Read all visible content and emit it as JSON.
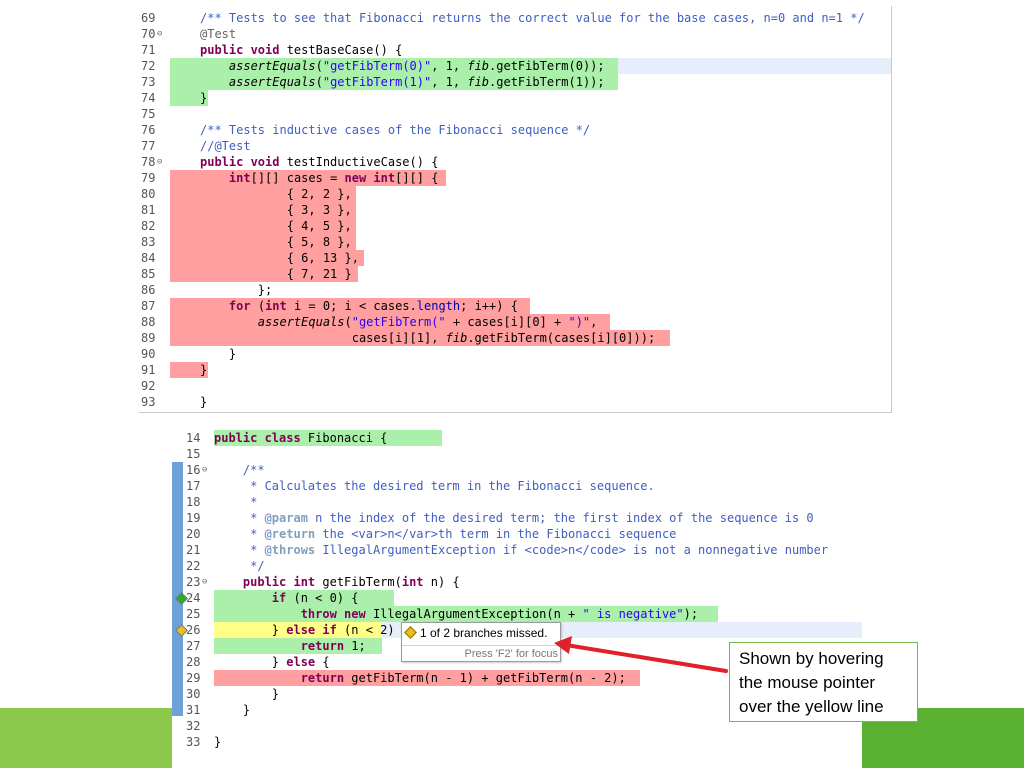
{
  "test_file": {
    "lines": [
      {
        "n": "69",
        "hl": "none",
        "parts": [
          [
            "cm",
            "/** Tests to see that Fibonacci returns the correct value for the base cases, n=0 and n=1 */"
          ]
        ]
      },
      {
        "n": "70",
        "fold": "⊖",
        "hl": "none",
        "parts": [
          [
            "ann",
            "@Test"
          ]
        ]
      },
      {
        "n": "71",
        "hl": "none",
        "parts": [
          [
            "kw",
            "public void "
          ],
          [
            "",
            "testBaseCase() {"
          ]
        ]
      },
      {
        "n": "72",
        "hl": "green",
        "cur": true,
        "parts": [
          [
            "",
            "    "
          ],
          [
            "st",
            "assertEquals"
          ],
          [
            "",
            "("
          ],
          [
            "str",
            "\"getFibTerm(0)\""
          ],
          [
            "",
            ", 1, "
          ],
          [
            "st",
            "fib"
          ],
          [
            "",
            ".getFibTerm(0));"
          ]
        ]
      },
      {
        "n": "73",
        "hl": "green",
        "parts": [
          [
            "",
            "    "
          ],
          [
            "st",
            "assertEquals"
          ],
          [
            "",
            "("
          ],
          [
            "str",
            "\"getFibTerm(1)\""
          ],
          [
            "",
            ", 1, "
          ],
          [
            "st",
            "fib"
          ],
          [
            "",
            ".getFibTerm(1));"
          ]
        ]
      },
      {
        "n": "74",
        "hl": "green-short",
        "parts": [
          [
            "",
            "}"
          ]
        ]
      },
      {
        "n": "75",
        "hl": "none",
        "parts": []
      },
      {
        "n": "76",
        "hl": "none",
        "parts": [
          [
            "cm",
            "/** Tests inductive cases of the Fibonacci sequence */"
          ]
        ]
      },
      {
        "n": "77",
        "hl": "none",
        "parts": [
          [
            "cm",
            "//@Test"
          ]
        ]
      },
      {
        "n": "78",
        "fold": "⊖",
        "hl": "none",
        "parts": [
          [
            "kw",
            "public void "
          ],
          [
            "",
            "testInductiveCase() {"
          ]
        ]
      },
      {
        "n": "79",
        "hl": "red",
        "w": 276,
        "parts": [
          [
            "",
            "    "
          ],
          [
            "kw",
            "int"
          ],
          [
            "",
            "[][] cases = "
          ],
          [
            "kw",
            "new int"
          ],
          [
            "",
            "[][] {"
          ]
        ]
      },
      {
        "n": "80",
        "hl": "red",
        "w": 186,
        "parts": [
          [
            "",
            "            { 2, 2 },"
          ]
        ]
      },
      {
        "n": "81",
        "hl": "red",
        "w": 186,
        "parts": [
          [
            "",
            "            { 3, 3 },"
          ]
        ]
      },
      {
        "n": "82",
        "hl": "red",
        "w": 186,
        "parts": [
          [
            "",
            "            { 4, 5 },"
          ]
        ]
      },
      {
        "n": "83",
        "hl": "red",
        "w": 186,
        "parts": [
          [
            "",
            "            { 5, 8 },"
          ]
        ]
      },
      {
        "n": "84",
        "hl": "red",
        "w": 194,
        "parts": [
          [
            "",
            "            { 6, 13 },"
          ]
        ]
      },
      {
        "n": "85",
        "hl": "red",
        "w": 188,
        "parts": [
          [
            "",
            "            { 7, 21 }"
          ]
        ]
      },
      {
        "n": "86",
        "hl": "none",
        "parts": [
          [
            "",
            "        };"
          ]
        ]
      },
      {
        "n": "87",
        "hl": "red",
        "w": 360,
        "parts": [
          [
            "",
            "    "
          ],
          [
            "kw",
            "for "
          ],
          [
            "",
            "("
          ],
          [
            "kw",
            "int "
          ],
          [
            "",
            "i = 0; i < cases."
          ],
          [
            "fld",
            "length"
          ],
          [
            "",
            "; i++) {"
          ]
        ]
      },
      {
        "n": "88",
        "hl": "red",
        "w": 440,
        "parts": [
          [
            "",
            "        "
          ],
          [
            "st",
            "assertEquals"
          ],
          [
            "",
            "("
          ],
          [
            "str",
            "\"getFibTerm(\""
          ],
          [
            "",
            " + cases[i][0] + "
          ],
          [
            "str",
            "\")\""
          ],
          [
            "",
            ","
          ]
        ]
      },
      {
        "n": "89",
        "hl": "red",
        "w": 500,
        "parts": [
          [
            "",
            "                     cases[i][1], "
          ],
          [
            "st",
            "fib"
          ],
          [
            "",
            ".getFibTerm(cases[i][0]));"
          ]
        ]
      },
      {
        "n": "90",
        "hl": "none",
        "parts": [
          [
            "",
            "    }"
          ]
        ]
      },
      {
        "n": "91",
        "hl": "red-short",
        "parts": [
          [
            "",
            "}"
          ]
        ]
      },
      {
        "n": "92",
        "hl": "none",
        "parts": []
      },
      {
        "n": "93",
        "hl": "none",
        "parts": [
          [
            "",
            "}"
          ]
        ]
      }
    ]
  },
  "source_file": {
    "lines": [
      {
        "n": "14",
        "hl": "green",
        "w": 228,
        "parts": [
          [
            "kw",
            "public class "
          ],
          [
            "",
            "Fibonacci {"
          ]
        ]
      },
      {
        "n": "15",
        "hl": "none",
        "parts": []
      },
      {
        "n": "16",
        "fold": "⊖",
        "hl": "none",
        "parts": [
          [
            "cm",
            "    /**"
          ]
        ]
      },
      {
        "n": "17",
        "hl": "none",
        "parts": [
          [
            "cm",
            "     * Calculates the desired term in the Fibonacci sequence."
          ]
        ]
      },
      {
        "n": "18",
        "hl": "none",
        "parts": [
          [
            "cm",
            "     *"
          ]
        ]
      },
      {
        "n": "19",
        "hl": "none",
        "parts": [
          [
            "cm",
            "     * "
          ],
          [
            "ph",
            "@param"
          ],
          [
            "cm",
            " n the index of the desired term; the first index of the sequence is 0"
          ]
        ]
      },
      {
        "n": "20",
        "hl": "none",
        "parts": [
          [
            "cm",
            "     * "
          ],
          [
            "ph",
            "@return"
          ],
          [
            "cm",
            " the <var>n</var>th term in the Fibonacci sequence"
          ]
        ]
      },
      {
        "n": "21",
        "hl": "none",
        "parts": [
          [
            "cm",
            "     * "
          ],
          [
            "ph",
            "@throws"
          ],
          [
            "cm",
            " IllegalArgumentException if <code>n</code> is not a nonnegative number"
          ]
        ]
      },
      {
        "n": "22",
        "hl": "none",
        "parts": [
          [
            "cm",
            "     */"
          ]
        ]
      },
      {
        "n": "23",
        "fold": "⊖",
        "hl": "none",
        "parts": [
          [
            "kw",
            "    public int "
          ],
          [
            "",
            "getFibTerm("
          ],
          [
            "kw",
            "int "
          ],
          [
            "",
            "n) {"
          ]
        ]
      },
      {
        "n": "24",
        "hl": "green",
        "w": 180,
        "marker": "green",
        "parts": [
          [
            "",
            "        "
          ],
          [
            "kw",
            "if "
          ],
          [
            "",
            "(n < 0) {"
          ]
        ]
      },
      {
        "n": "25",
        "hl": "green",
        "w": 504,
        "parts": [
          [
            "",
            "            "
          ],
          [
            "kw",
            "throw new "
          ],
          [
            "",
            "IllegalArgumentException(n + "
          ],
          [
            "str",
            "\" is negative\""
          ],
          [
            "",
            ");"
          ]
        ]
      },
      {
        "n": "26",
        "hl": "yellow",
        "w": 168,
        "marker": "yellow",
        "cur": true,
        "parts": [
          [
            "",
            "        } "
          ],
          [
            "kw",
            "else if "
          ],
          [
            "",
            "(n < 2) {"
          ]
        ]
      },
      {
        "n": "27",
        "hl": "green",
        "w": 168,
        "parts": [
          [
            "",
            "            "
          ],
          [
            "kw",
            "return "
          ],
          [
            "",
            "1;"
          ]
        ]
      },
      {
        "n": "28",
        "hl": "none",
        "parts": [
          [
            "",
            "        } "
          ],
          [
            "kw",
            "else "
          ],
          [
            "",
            "{"
          ]
        ]
      },
      {
        "n": "29",
        "hl": "red",
        "w": 426,
        "parts": [
          [
            "",
            "            "
          ],
          [
            "kw",
            "return "
          ],
          [
            "",
            "getFibTerm(n - 1) + getFibTerm(n - 2);"
          ]
        ]
      },
      {
        "n": "30",
        "hl": "none",
        "parts": [
          [
            "",
            "        }"
          ]
        ]
      },
      {
        "n": "31",
        "hl": "none",
        "parts": [
          [
            "",
            "    }"
          ]
        ]
      },
      {
        "n": "32",
        "hl": "none",
        "parts": []
      },
      {
        "n": "33",
        "hl": "none",
        "parts": [
          [
            "",
            "}"
          ]
        ]
      }
    ]
  },
  "tooltip": {
    "message": "1 of 2 branches missed.",
    "hint": "Press 'F2' for focus"
  },
  "callout": {
    "lines": [
      "Shown by hovering",
      "the mouse pointer",
      "over the yellow line"
    ]
  },
  "colors": {
    "covered": "#aaf0aa",
    "missed": "#ff9f9f",
    "partial": "#ffff88",
    "accent_green": "#8cc84b",
    "arrow": "#e0202a"
  }
}
